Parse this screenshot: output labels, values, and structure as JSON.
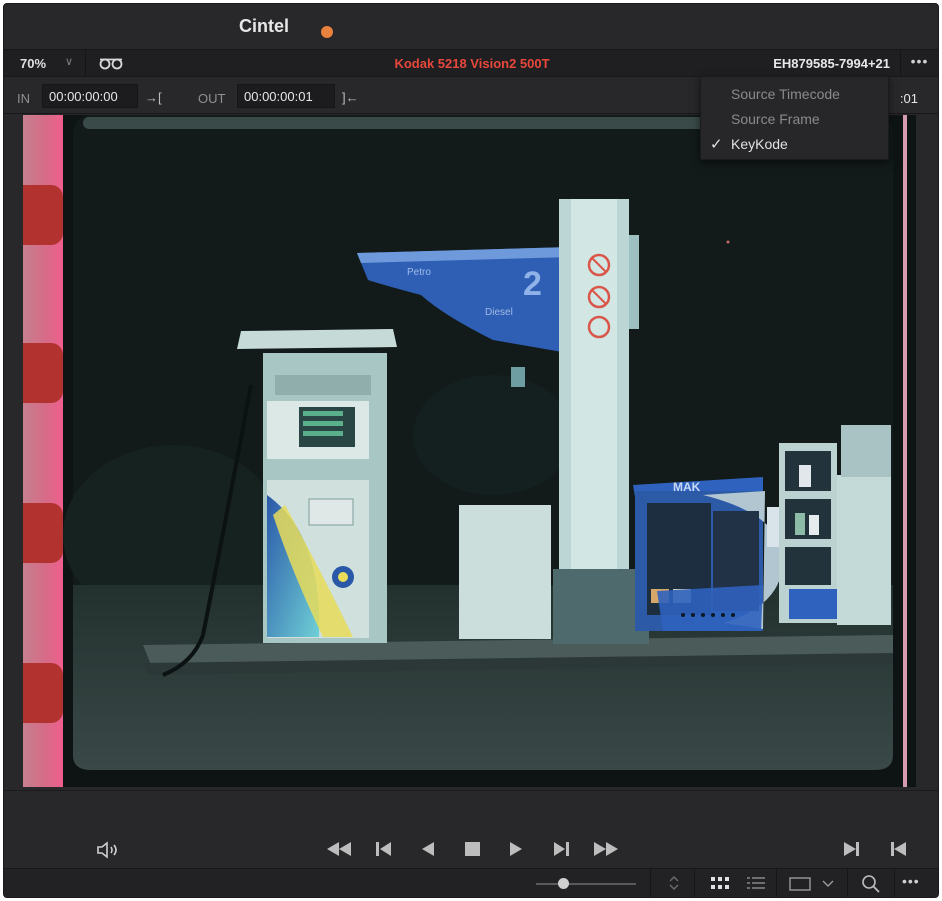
{
  "window": {
    "title": "Cintel",
    "status_color": "#e9823e"
  },
  "toolbar": {
    "zoom": "70%",
    "film_stock": "Kodak 5218 Vision2 500T",
    "keycode": "EH879585-7994+21",
    "more_label": "•••"
  },
  "in_out": {
    "in_label": "IN",
    "in_value": "00:00:00:00",
    "in_mark": "→[",
    "out_label": "OUT",
    "out_value": "00:00:00:01",
    "out_mark": "]←",
    "timecode_tail": ":01"
  },
  "menu": {
    "items": [
      {
        "label": "Source Timecode",
        "checked": false
      },
      {
        "label": "Source Frame",
        "checked": false
      },
      {
        "label": "KeyKode",
        "checked": true
      }
    ],
    "check_glyph": "✓"
  },
  "viewer": {
    "canopy_text": "2",
    "canopy_subtext": "Petro",
    "canopy_subtext2": "Diesel",
    "shop_sign": "MAK"
  },
  "transport": {
    "buttons": [
      "volume-icon",
      "jog-backward-icon",
      "previous-frame-icon",
      "play-reverse-icon",
      "stop-icon",
      "play-icon",
      "next-frame-icon",
      "jog-forward-icon",
      "go-to-last-frame-icon",
      "go-to-first-frame-icon"
    ]
  },
  "bottombar": {
    "slider_value": 0.25,
    "more_label": "•••"
  },
  "colors": {
    "accent_red": "#e8473b",
    "panel_bg": "#28282b",
    "film_edge": "#e4567e"
  }
}
